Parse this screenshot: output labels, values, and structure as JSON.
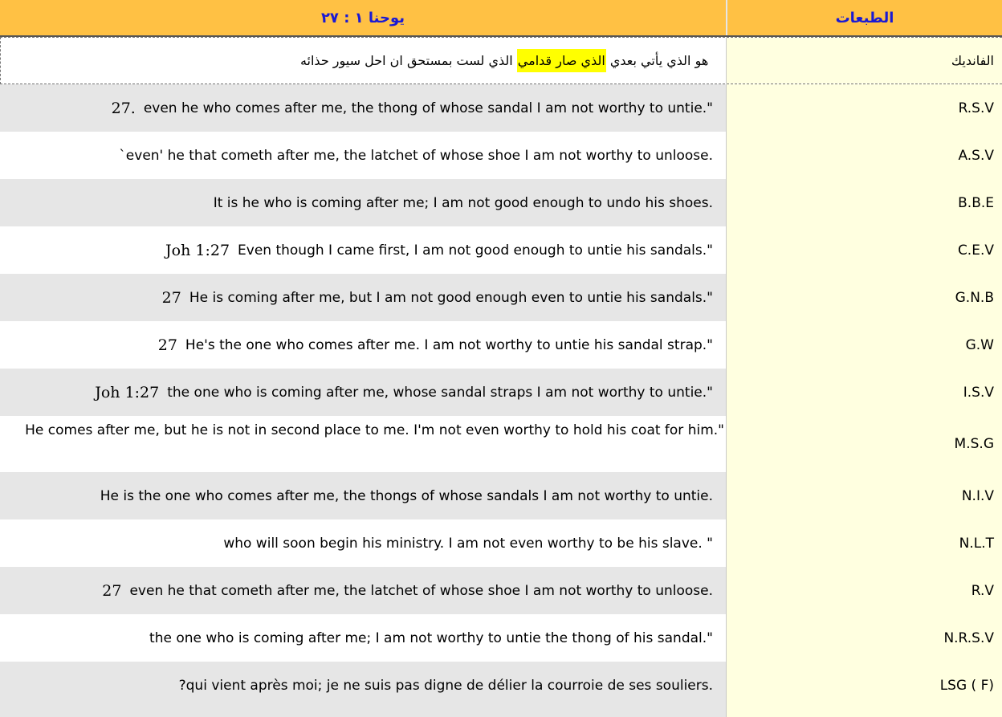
{
  "header": {
    "reference": "يوحنا ١ : ٢٧",
    "versions_heading": "الطبعات"
  },
  "arabic_row": {
    "label": "الفانديك",
    "text_before": "هو الذي يأتي بعدي ",
    "text_highlight": "الذي صار قدامي",
    "text_after": " الذي لست بمستحق ان احل سيور حذائه",
    "highlight_color": "#ffff00"
  },
  "versions": [
    {
      "label": "R.S.V",
      "prefix": "27.",
      "text": "even he who comes after me, the thong of whose sandal I am not worthy to untie.\""
    },
    {
      "label": "A.S.V",
      "prefix": "",
      "text": "`even' he that cometh after me, the latchet of whose shoe I am not worthy to unloose."
    },
    {
      "label": "B.B.E",
      "prefix": "",
      "text": "It is he who is coming after me; I am not good enough to undo his shoes."
    },
    {
      "label": "C.E.V",
      "prefix": "Joh 1:27",
      "text": "Even though I came first, I am not good enough to untie his sandals.\""
    },
    {
      "label": "G.N.B",
      "prefix": "27",
      "text": "He is coming after me, but I am not good enough even to untie his sandals.\""
    },
    {
      "label": "G.W",
      "prefix": "27",
      "text": "He's the one who comes after me. I am not worthy to untie his sandal strap.\""
    },
    {
      "label": "I.S.V",
      "prefix": "Joh 1:27",
      "text": "the one who is coming after me, whose sandal straps I am not worthy to untie.\""
    },
    {
      "label": "M.S.G",
      "prefix": "",
      "text": "He comes after me, but he is not in second place to me. I'm not even worthy to hold his coat for him.\""
    },
    {
      "label": "N.I.V",
      "prefix": "",
      "text": "He is the one who comes after me, the thongs of whose sandals I am not worthy to untie."
    },
    {
      "label": "N.L.T",
      "prefix": "",
      "text": "who will soon begin his ministry. I am not even worthy to be his slave. \""
    },
    {
      "label": "R.V",
      "prefix": "27",
      "text": "even he that cometh after me, the latchet of whose shoe I am not worthy to unloose."
    },
    {
      "label": "N.R.S.V",
      "prefix": "",
      "text": "the one who is coming after me; I am not worthy to untie the thong of his sandal.\""
    },
    {
      "label": "LSG ( F)",
      "prefix": "",
      "text": "?qui vient après moi; je ne suis pas digne de délier la courroie de ses souliers."
    }
  ],
  "colors": {
    "header_bg": "#ffc144",
    "header_text": "#1a1ad4",
    "label_bg": "#ffffe0",
    "alt_row_bg": "#e6e6e6"
  }
}
